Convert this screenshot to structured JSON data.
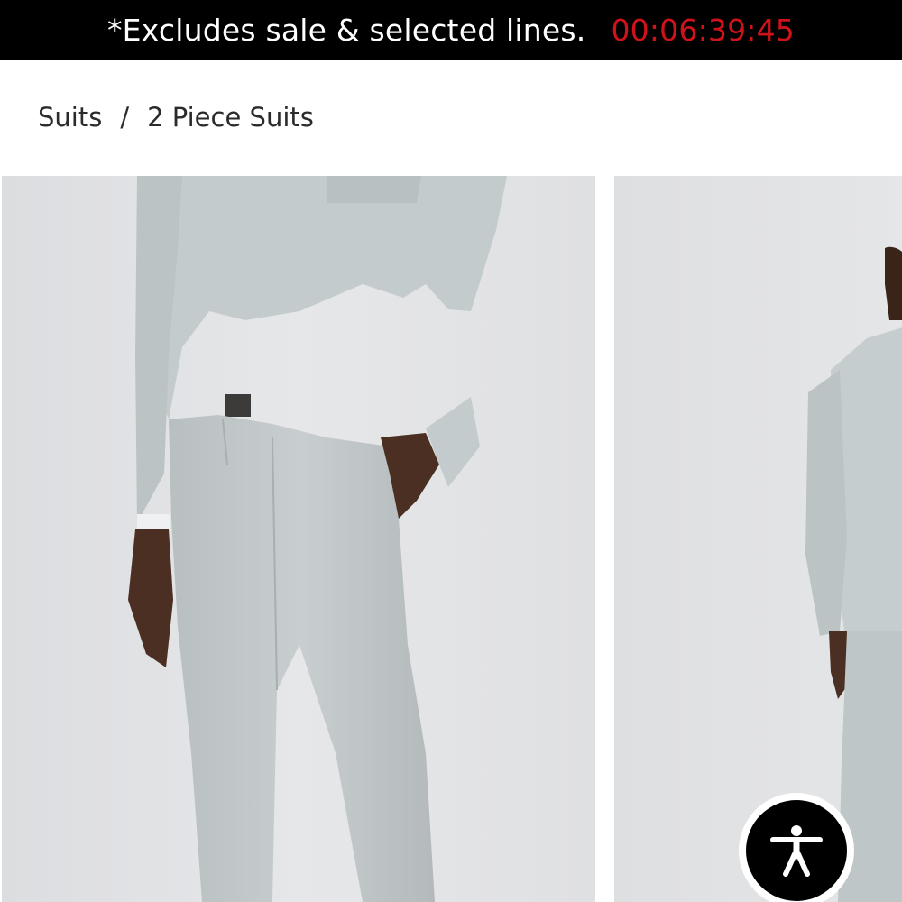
{
  "promo_bar": {
    "message": "*Excludes sale & selected lines.",
    "countdown": "00:06:39:45",
    "countdown_color": "#d0121b",
    "background": "#000000"
  },
  "breadcrumb": {
    "items": [
      {
        "label": "Suits"
      },
      {
        "label": "2 Piece Suits"
      }
    ],
    "separator": "/"
  },
  "gallery": {
    "images": [
      {
        "icon": "product-photo-front"
      },
      {
        "icon": "product-photo-back"
      }
    ]
  },
  "accessibility": {
    "icon": "accessibility-icon"
  }
}
